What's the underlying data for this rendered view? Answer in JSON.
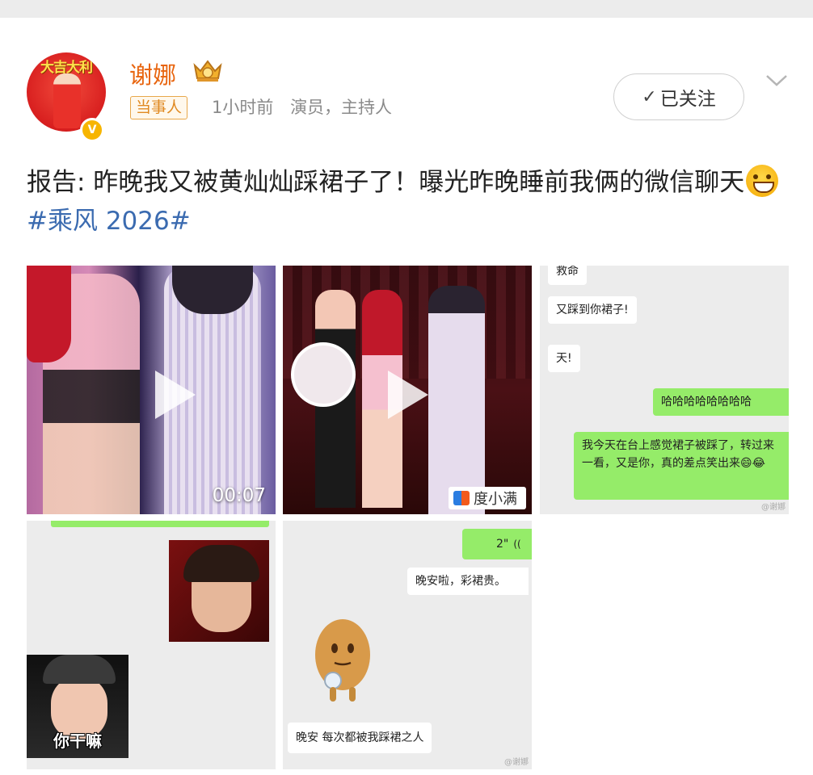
{
  "post": {
    "username": "谢娜",
    "role_tag": "当事人",
    "time": "1小时前",
    "bio": "演员，主持人",
    "follow_label": "已关注",
    "text_part1": "报告: 昨晚我又被黄灿灿踩裙子了！曝光昨晚睡前我俩的微信聊天",
    "hashtag": "#乘风 2026#",
    "avatar_banner": "大吉大利",
    "verify_mark": "V"
  },
  "media": {
    "video_duration": "00:07",
    "video_logo": "度小满",
    "chat1": {
      "cut_top": "救命",
      "msg1": "又踩到你裙子!",
      "msg2": "天!",
      "msg3": "哈哈哈哈哈哈哈哈",
      "msg4": "我今天在台上感觉裙子被踩了，转过来一看，又是你，真的差点笑出来😄😂",
      "watermark": "@谢娜"
    },
    "meme_caption": "你干嘛",
    "chat2": {
      "voice_duration": "2\"",
      "msg1": "晚安啦，彩裙贵。",
      "msg2": "晚安 每次都被我踩裙之人",
      "watermark": "@谢娜"
    }
  },
  "colors": {
    "username": "#e8650f",
    "hashtag": "#3b6bb0",
    "wechat_green": "#95ec69"
  }
}
